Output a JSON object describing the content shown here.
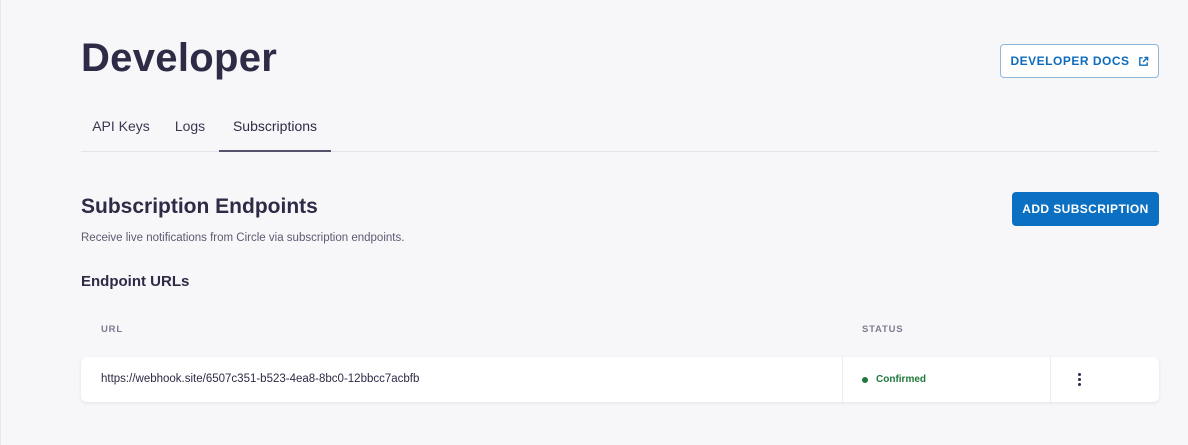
{
  "header": {
    "title": "Developer",
    "docs_button": {
      "label": "DEVELOPER DOCS",
      "icon": "external-link-icon"
    }
  },
  "tabs": [
    {
      "label": "API Keys",
      "active": false
    },
    {
      "label": "Logs",
      "active": false
    },
    {
      "label": "Subscriptions",
      "active": true
    }
  ],
  "section": {
    "title": "Subscription Endpoints",
    "subtitle": "Receive live notifications from Circle via subscription endpoints.",
    "add_button": "ADD SUBSCRIPTION"
  },
  "endpoints": {
    "title": "Endpoint URLs",
    "columns": {
      "url": "URL",
      "status": "STATUS"
    },
    "rows": [
      {
        "url": "https://webhook.site/6507c351-b523-4ea8-8bc0-12bbcc7acbfb",
        "status": "Confirmed",
        "status_color": "#1f7a3a",
        "menu_icon": "kebab-menu-icon"
      }
    ]
  },
  "colors": {
    "accent": "#0b6fc2",
    "text": "#2d2b45",
    "background": "#f7f7fa"
  }
}
